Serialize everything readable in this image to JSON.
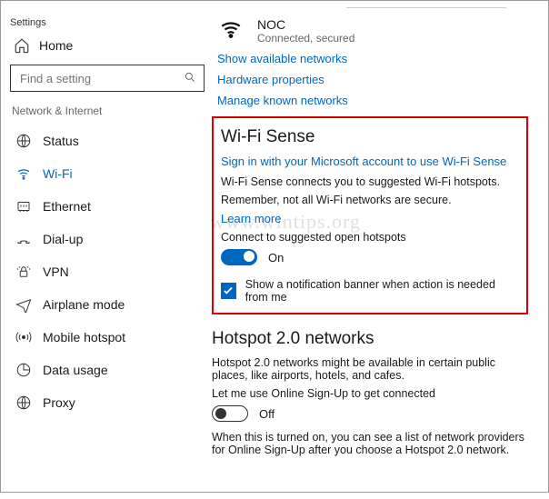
{
  "app_title": "Settings",
  "home_label": "Home",
  "search_placeholder": "Find a setting",
  "group_title": "Network & Internet",
  "nav": [
    {
      "label": "Status"
    },
    {
      "label": "Wi-Fi"
    },
    {
      "label": "Ethernet"
    },
    {
      "label": "Dial-up"
    },
    {
      "label": "VPN"
    },
    {
      "label": "Airplane mode"
    },
    {
      "label": "Mobile hotspot"
    },
    {
      "label": "Data usage"
    },
    {
      "label": "Proxy"
    }
  ],
  "connection": {
    "name": "NOC",
    "status": "Connected, secured"
  },
  "links": {
    "show_available": "Show available networks",
    "hardware_props": "Hardware properties",
    "manage_known": "Manage known networks"
  },
  "wifi_sense": {
    "title": "Wi-Fi Sense",
    "signin_link": "Sign in with your Microsoft account to use Wi-Fi Sense",
    "desc": "Wi-Fi Sense connects you to suggested Wi-Fi hotspots.",
    "remember": "Remember, not all Wi-Fi networks are secure.",
    "learn_more": "Learn more",
    "connect_label": "Connect to suggested open hotspots",
    "toggle_state": "On",
    "notif_label": "Show a notification banner when action is needed from me"
  },
  "hotspot20": {
    "title": "Hotspot 2.0 networks",
    "desc": "Hotspot 2.0 networks might be available in certain public places, like airports, hotels, and cafes.",
    "signup_label": "Let me use Online Sign-Up to get connected",
    "toggle_state": "Off",
    "note": "When this is turned on, you can see a list of network providers for Online Sign-Up after you choose a Hotspot 2.0 network."
  },
  "watermark": "www.wintips.org"
}
